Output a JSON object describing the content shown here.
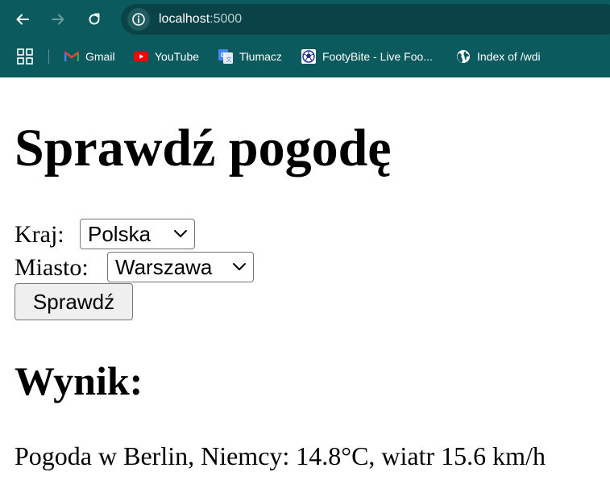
{
  "browser": {
    "url_host": "localhost",
    "url_port": ":5000",
    "bookmarks": [
      {
        "label": "Gmail",
        "icon": "gmail-icon"
      },
      {
        "label": "YouTube",
        "icon": "youtube-icon"
      },
      {
        "label": "Tłumacz",
        "icon": "google-translate-icon"
      },
      {
        "label": "FootyBite - Live Foo...",
        "icon": "soccer-ball-icon"
      },
      {
        "label": "Index of /wdi",
        "icon": "globe-icon"
      }
    ],
    "colors": {
      "frame": "#0b5a5e",
      "omnibox": "#0a4347"
    }
  },
  "page": {
    "title": "Sprawdź pogodę",
    "country_label": "Kraj:",
    "country_selected": "Polska",
    "city_label": "Miasto:",
    "city_selected": "Warszawa",
    "submit_label": "Sprawdź",
    "result_heading": "Wynik:",
    "result_text": "Pogoda w Berlin, Niemcy: 14.8°C, wiatr 15.6 km/h"
  }
}
